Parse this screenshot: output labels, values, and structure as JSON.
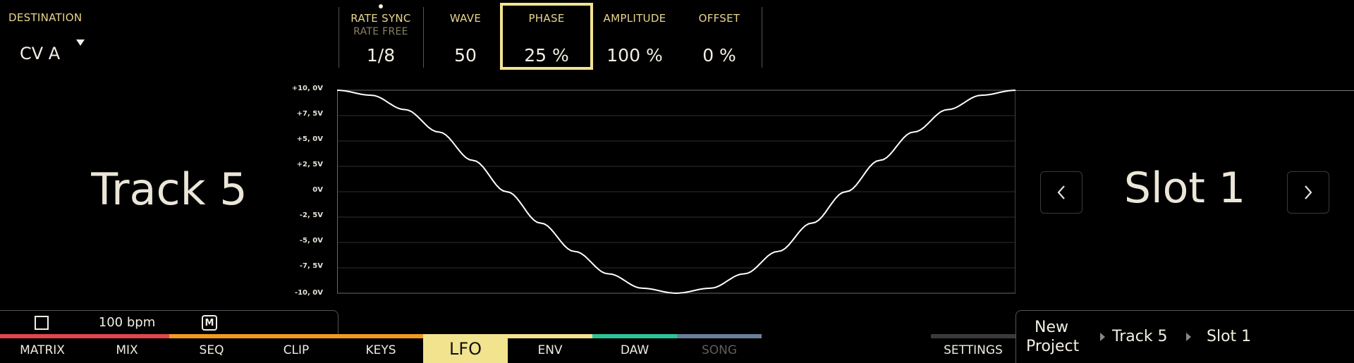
{
  "destination": {
    "label": "DESTINATION",
    "value": "CV A"
  },
  "params": [
    {
      "label": "RATE SYNC",
      "sublabel": "RATE FREE",
      "value": "1/8"
    },
    {
      "label": "WAVE",
      "value": "50"
    },
    {
      "label": "PHASE",
      "value": "25 %"
    },
    {
      "label": "AMPLITUDE",
      "value": "100 %"
    },
    {
      "label": "OFFSET",
      "value": "0 %"
    }
  ],
  "track_title": "Track 5",
  "slot_title": "Slot 1",
  "chart_data": {
    "type": "line",
    "y_tick_labels": [
      "+10, 0V",
      "+7, 5V",
      "+5, 0V",
      "+2, 5V",
      "0V",
      "-2, 5V",
      "-5, 0V",
      "-7, 5V",
      "-10, 0V"
    ],
    "ylim": [
      -10,
      10
    ],
    "grid": true,
    "series": [
      {
        "x": [
          0,
          0.05,
          0.1,
          0.15,
          0.2,
          0.25,
          0.3,
          0.35,
          0.4,
          0.45,
          0.5,
          0.55,
          0.6,
          0.65,
          0.7,
          0.75,
          0.8,
          0.85,
          0.9,
          0.95,
          1.0
        ],
        "values": [
          10,
          9.51,
          8.09,
          5.88,
          3.09,
          0,
          -3.09,
          -5.88,
          -8.09,
          -9.51,
          -10,
          -9.51,
          -8.09,
          -5.88,
          -3.09,
          0,
          3.09,
          5.88,
          8.09,
          9.51,
          10
        ]
      }
    ]
  },
  "transport": {
    "tempo": "100 bpm",
    "m_label": "M"
  },
  "tabs": [
    "MATRIX",
    "MIX",
    "SEQ",
    "CLIP",
    "KEYS",
    "LFO",
    "ENV",
    "DAW",
    "SONG"
  ],
  "active_tab": "LFO",
  "settings_label": "SETTINGS",
  "breadcrumb": [
    "New Project",
    "Track 5",
    "Slot 1"
  ],
  "colors": {
    "accent": "#f2e38f",
    "strip_red": "#e0464b",
    "strip_orange": "#f29a1e",
    "strip_yellow": "#f2e38f",
    "strip_green": "#2ec49a",
    "strip_slate": "#6b7f99"
  },
  "icons": {
    "stop": "square-outline",
    "prev": "chevron-left",
    "next": "chevron-right",
    "dropdown": "triangle-down"
  }
}
